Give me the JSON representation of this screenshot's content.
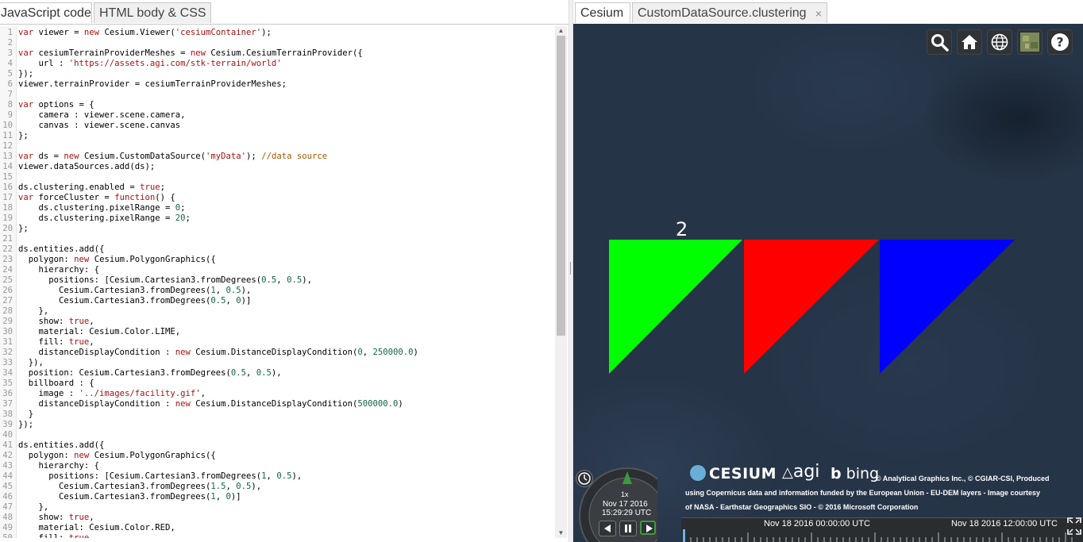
{
  "left_tabs": {
    "js": "JavaScript code",
    "html": "HTML body & CSS"
  },
  "right_tabs": {
    "cesium": "Cesium",
    "clustering": "CustomDataSource.clustering",
    "close": "×"
  },
  "toolbar_icons": [
    "search-icon",
    "home-icon",
    "globe-icon",
    "imagery-layer-icon",
    "help-icon"
  ],
  "code_lines": [
    [
      {
        "t": "var",
        "c": "kw"
      },
      {
        "t": " viewer = "
      },
      {
        "t": "new",
        "c": "kw"
      },
      {
        "t": " Cesium.Viewer("
      },
      {
        "t": "'cesiumContainer'",
        "c": "str"
      },
      {
        "t": ");"
      }
    ],
    [],
    [
      {
        "t": "var",
        "c": "kw"
      },
      {
        "t": " cesiumTerrainProviderMeshes = "
      },
      {
        "t": "new",
        "c": "kw"
      },
      {
        "t": " Cesium.CesiumTerrainProvider({"
      }
    ],
    [
      {
        "t": "    url : "
      },
      {
        "t": "'https://assets.agi.com/stk-terrain/world'",
        "c": "str"
      }
    ],
    [
      {
        "t": "});"
      }
    ],
    [
      {
        "t": "viewer.terrainProvider = cesiumTerrainProviderMeshes;"
      }
    ],
    [],
    [
      {
        "t": "var",
        "c": "kw"
      },
      {
        "t": " options = {"
      }
    ],
    [
      {
        "t": "    camera : viewer.scene.camera,"
      }
    ],
    [
      {
        "t": "    canvas : viewer.scene.canvas"
      }
    ],
    [
      {
        "t": "};"
      }
    ],
    [],
    [
      {
        "t": "var",
        "c": "kw"
      },
      {
        "t": " ds = "
      },
      {
        "t": "new",
        "c": "kw"
      },
      {
        "t": " Cesium.CustomDataSource("
      },
      {
        "t": "'myData'",
        "c": "str"
      },
      {
        "t": "); "
      },
      {
        "t": "//data source",
        "c": "cmt"
      }
    ],
    [
      {
        "t": "viewer.dataSources.add(ds);"
      }
    ],
    [],
    [
      {
        "t": "ds.clustering.enabled = "
      },
      {
        "t": "true",
        "c": "kw"
      },
      {
        "t": ";"
      }
    ],
    [
      {
        "t": "var",
        "c": "kw"
      },
      {
        "t": " forceCluster = "
      },
      {
        "t": "function",
        "c": "kw"
      },
      {
        "t": "() {"
      }
    ],
    [
      {
        "t": "    ds.clustering.pixelRange = "
      },
      {
        "t": "0",
        "c": "num"
      },
      {
        "t": ";"
      }
    ],
    [
      {
        "t": "    ds.clustering.pixelRange = "
      },
      {
        "t": "20",
        "c": "num"
      },
      {
        "t": ";"
      }
    ],
    [
      {
        "t": "};"
      }
    ],
    [],
    [
      {
        "t": "ds.entities.add({"
      }
    ],
    [
      {
        "t": "  polygon: "
      },
      {
        "t": "new",
        "c": "kw"
      },
      {
        "t": " Cesium.PolygonGraphics({"
      }
    ],
    [
      {
        "t": "    hierarchy: {"
      }
    ],
    [
      {
        "t": "      positions: [Cesium.Cartesian3.fromDegrees("
      },
      {
        "t": "0.5",
        "c": "num"
      },
      {
        "t": ", "
      },
      {
        "t": "0.5",
        "c": "num"
      },
      {
        "t": "),"
      }
    ],
    [
      {
        "t": "        Cesium.Cartesian3.fromDegrees("
      },
      {
        "t": "1",
        "c": "num"
      },
      {
        "t": ", "
      },
      {
        "t": "0.5",
        "c": "num"
      },
      {
        "t": "),"
      }
    ],
    [
      {
        "t": "        Cesium.Cartesian3.fromDegrees("
      },
      {
        "t": "0.5",
        "c": "num"
      },
      {
        "t": ", "
      },
      {
        "t": "0",
        "c": "num"
      },
      {
        "t": ")]"
      }
    ],
    [
      {
        "t": "    },"
      }
    ],
    [
      {
        "t": "    show: "
      },
      {
        "t": "true",
        "c": "kw"
      },
      {
        "t": ","
      }
    ],
    [
      {
        "t": "    material: Cesium.Color.LIME,"
      }
    ],
    [
      {
        "t": "    fill: "
      },
      {
        "t": "true",
        "c": "kw"
      },
      {
        "t": ","
      }
    ],
    [
      {
        "t": "    distanceDisplayCondition : "
      },
      {
        "t": "new",
        "c": "kw"
      },
      {
        "t": " Cesium.DistanceDisplayCondition("
      },
      {
        "t": "0",
        "c": "num"
      },
      {
        "t": ", "
      },
      {
        "t": "250000.0",
        "c": "num"
      },
      {
        "t": ")"
      }
    ],
    [
      {
        "t": "  }),"
      }
    ],
    [
      {
        "t": "  position: Cesium.Cartesian3.fromDegrees("
      },
      {
        "t": "0.5",
        "c": "num"
      },
      {
        "t": ", "
      },
      {
        "t": "0.5",
        "c": "num"
      },
      {
        "t": "),"
      }
    ],
    [
      {
        "t": "  billboard : {"
      }
    ],
    [
      {
        "t": "    image : "
      },
      {
        "t": "'../images/facility.gif'",
        "c": "str"
      },
      {
        "t": ","
      }
    ],
    [
      {
        "t": "    distanceDisplayCondition : "
      },
      {
        "t": "new",
        "c": "kw"
      },
      {
        "t": " Cesium.DistanceDisplayCondition("
      },
      {
        "t": "500000.0",
        "c": "num"
      },
      {
        "t": ")"
      }
    ],
    [
      {
        "t": "  }"
      }
    ],
    [
      {
        "t": "});"
      }
    ],
    [],
    [
      {
        "t": "ds.entities.add({"
      }
    ],
    [
      {
        "t": "  polygon: "
      },
      {
        "t": "new",
        "c": "kw"
      },
      {
        "t": " Cesium.PolygonGraphics({"
      }
    ],
    [
      {
        "t": "    hierarchy: {"
      }
    ],
    [
      {
        "t": "      positions: [Cesium.Cartesian3.fromDegrees("
      },
      {
        "t": "1",
        "c": "num"
      },
      {
        "t": ", "
      },
      {
        "t": "0.5",
        "c": "num"
      },
      {
        "t": "),"
      }
    ],
    [
      {
        "t": "        Cesium.Cartesian3.fromDegrees("
      },
      {
        "t": "1.5",
        "c": "num"
      },
      {
        "t": ", "
      },
      {
        "t": "0.5",
        "c": "num"
      },
      {
        "t": "),"
      }
    ],
    [
      {
        "t": "        Cesium.Cartesian3.fromDegrees("
      },
      {
        "t": "1",
        "c": "num"
      },
      {
        "t": ", "
      },
      {
        "t": "0",
        "c": "num"
      },
      {
        "t": ")]"
      }
    ],
    [
      {
        "t": "    },"
      }
    ],
    [
      {
        "t": "    show: "
      },
      {
        "t": "true",
        "c": "kw"
      },
      {
        "t": ","
      }
    ],
    [
      {
        "t": "    material: Cesium.Color.RED,"
      }
    ],
    [
      {
        "t": "    fill: "
      },
      {
        "t": "true",
        "c": "kw"
      }
    ]
  ],
  "viewer": {
    "cluster_count": "2",
    "polygons": [
      {
        "name": "lime",
        "color": "#00ff00"
      },
      {
        "name": "red",
        "color": "#ff0000"
      },
      {
        "name": "blue",
        "color": "#0000ff"
      }
    ]
  },
  "credits": {
    "cesium": "CESIUM",
    "agi": "agi",
    "bing": "bing",
    "line1": "© Analytical Graphics Inc., © CGIAR-CSI, Produced",
    "line2": "using Copernicus data and information funded by the European Union - EU-DEM layers - Image courtesy",
    "line3": "of NASA - Earthstar Geographics SIO - © 2016 Microsoft Corporation"
  },
  "animation": {
    "speed": "1x",
    "date": "Nov 17 2016",
    "time": "15:29:29 UTC"
  },
  "timeline": {
    "label1": "Nov 18 2016 00:00:00 UTC",
    "label2": "Nov 18 2016 12:00:00 UTC"
  }
}
